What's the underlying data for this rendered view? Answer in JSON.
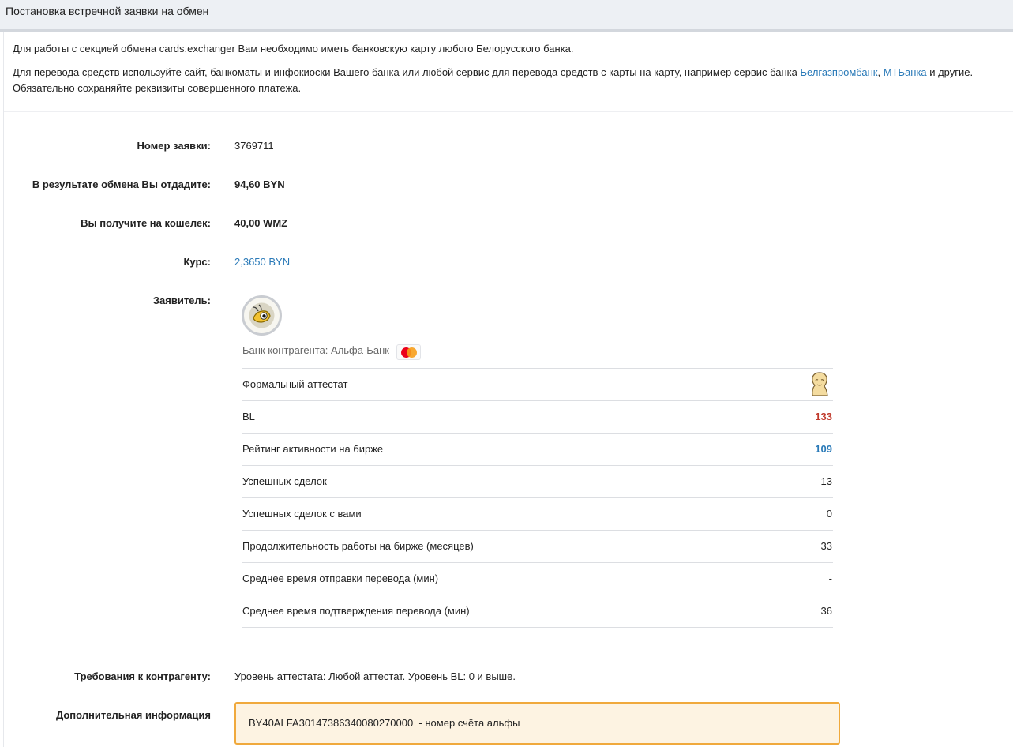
{
  "header": {
    "title": "Постановка встречной заявки на обмен"
  },
  "notice": {
    "line1": "Для работы с секцией обмена cards.exchanger Вам необходимо иметь банковскую карту любого Белорусского банка.",
    "line2_before": "Для перевода средств используйте сайт, банкоматы и инфокиоски Вашего банка или любой сервис для перевода средств с карты на карту, например сервис банка ",
    "link_belgazprom": "Белгазпромбанк",
    "comma": ", ",
    "link_mtbank": "МТБанка",
    "line2_after": " и другие.",
    "line3": "Обязательно сохраняйте реквизиты совершенного платежа."
  },
  "order": {
    "number_label": "Номер заявки:",
    "number_value": "3769711",
    "give_label": "В результате обмена Вы отдадите:",
    "give_value": "94,60 BYN",
    "receive_label": "Вы получите на кошелек:",
    "receive_value": "40,00 WMZ",
    "rate_label": "Курс:",
    "rate_value": "2,3650 BYN",
    "applicant_label": "Заявитель:"
  },
  "applicant": {
    "avatar_icon": "webmoney-bug-icon",
    "bank_text": "Банк контрагента: Альфа-Банк",
    "card_icon": "mastercard-icon",
    "stats": [
      {
        "name": "Формальный аттестат",
        "value": "",
        "icon": "formal-attestat-icon"
      },
      {
        "name": "BL",
        "value": "133",
        "color": "#c0392b"
      },
      {
        "name": "Рейтинг активности на бирже",
        "value": "109",
        "color": "#2a7ab8"
      },
      {
        "name": "Успешных сделок",
        "value": "13"
      },
      {
        "name": "Успешных сделок с вами",
        "value": "0"
      },
      {
        "name": "Продолжительность работы на бирже (месяцев)",
        "value": "33"
      },
      {
        "name": "Среднее время отправки перевода (мин)",
        "value": "-"
      },
      {
        "name": "Среднее время подтверждения перевода (мин)",
        "value": "36"
      }
    ]
  },
  "requirements": {
    "label": "Требования к контрагенту:",
    "value": "Уровень аттестата: Любой аттестат. Уровень BL: 0 и выше."
  },
  "additional": {
    "label": "Дополнительная информация",
    "value": "BY40ALFA30147386340080270000  - номер счёта альфы"
  },
  "colors": {
    "link": "#2a7ab8",
    "bl": "#c0392b",
    "box_border": "#f0a93c",
    "box_bg": "#fdf3e2"
  }
}
